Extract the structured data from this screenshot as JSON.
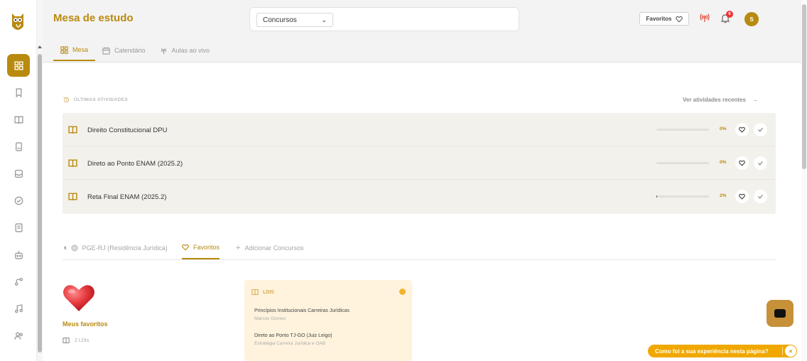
{
  "header": {
    "title": "Mesa de estudo",
    "select_value": "Concursos",
    "favorites_label": "Favoritos",
    "notification_count": "6",
    "avatar_initial": "S"
  },
  "nav_tabs": [
    {
      "label": "Mesa",
      "icon": "grid-icon",
      "active": true
    },
    {
      "label": "Calendário",
      "icon": "calendar-icon",
      "active": false
    },
    {
      "label": "Aulas ao vivo",
      "icon": "broadcast-icon",
      "active": false
    }
  ],
  "sidebar": {
    "items": [
      {
        "icon": "dashboard-icon",
        "active": true
      },
      {
        "icon": "bookmark-icon"
      },
      {
        "icon": "book-open-icon"
      },
      {
        "icon": "notebook-icon"
      },
      {
        "icon": "inbox-icon"
      },
      {
        "icon": "check-circle-icon"
      },
      {
        "icon": "document-icon"
      },
      {
        "icon": "robot-icon"
      },
      {
        "icon": "route-icon"
      },
      {
        "icon": "music-icon"
      },
      {
        "icon": "users-icon"
      }
    ]
  },
  "activities": {
    "heading": "ÚLTIMAS ATIVIDADES",
    "see_recent_label": "Ver atividades recentes",
    "items": [
      {
        "title": "Direito Constitucional DPU",
        "progress_percent": 0,
        "progress_label": "0%"
      },
      {
        "title": "Direto ao Ponto ENAM (2025.2)",
        "progress_percent": 0,
        "progress_label": "0%"
      },
      {
        "title": "Reta Final ENAM (2025.2)",
        "progress_percent": 2,
        "progress_label": "2%"
      }
    ]
  },
  "contest_tabs": {
    "contest_label": "PGE-RJ (Residência Jurídica)",
    "favorites_label": "Favoritos",
    "add_label": "Adicionar Concursos"
  },
  "favorites": {
    "title": "Meus favoritos",
    "count_label": "2 LDIs"
  },
  "ldi_card": {
    "header": "LDIS",
    "items": [
      {
        "title": "Princípios Institucionais Carreiras Jurídicas",
        "author": "Marcos Gomes"
      },
      {
        "title": "Direto ao Ponto TJ-GO (Juiz Leigo)",
        "author": "Estratégia Carreira Jurídica e OAB"
      }
    ]
  },
  "feedback": {
    "label": "Como foi a sua experiência nesta página?",
    "close": "×"
  },
  "colors": {
    "brand": "#b88a0e",
    "alert": "#e0402e",
    "feedback_bg": "#f0a800"
  }
}
